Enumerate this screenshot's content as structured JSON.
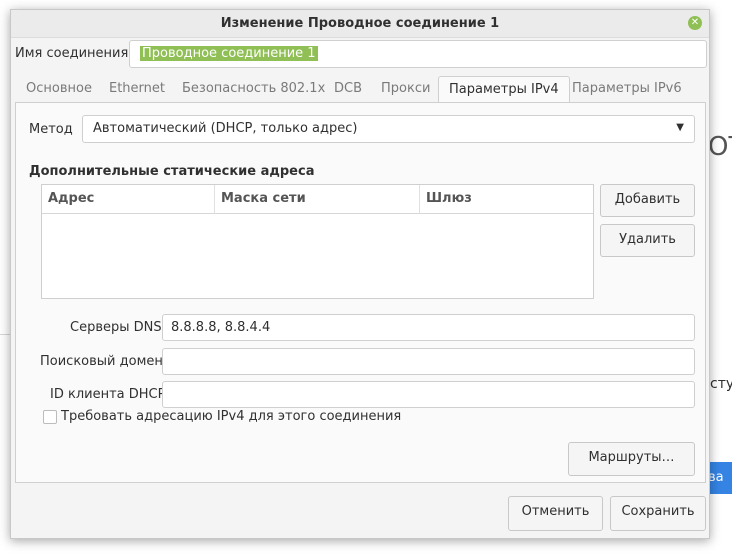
{
  "background": {
    "big_text": "OT",
    "text": "сту",
    "button_label": "ва",
    "accent": "#3584e4"
  },
  "dialog": {
    "title": "Изменение Проводное соединение 1",
    "close_icon": "close-icon"
  },
  "connection_name": {
    "label": "Имя соединения",
    "value": "Проводное соединение 1"
  },
  "tabs": [
    {
      "label": "Основное"
    },
    {
      "label": "Ethernet"
    },
    {
      "label": "Безопасность 802.1x"
    },
    {
      "label": "DCB"
    },
    {
      "label": "Прокси"
    },
    {
      "label": "Параметры IPv4"
    },
    {
      "label": "Параметры IPv6"
    }
  ],
  "active_tab": "Параметры IPv4",
  "ipv4": {
    "method_label": "Метод",
    "method_value": "Автоматический (DHCP, только адрес)",
    "static_title": "Дополнительные статические адреса",
    "columns": [
      "Адрес",
      "Маска сети",
      "Шлюз"
    ],
    "add_button": "Добавить",
    "delete_button": "Удалить",
    "dns_label": "Серверы DNS",
    "dns_value": "8.8.8.8, 8.8.4.4",
    "search_domain_label": "Поисковый домен",
    "search_domain_value": "",
    "dhcp_client_label": "ID клиента DHCP",
    "dhcp_client_value": "",
    "require_ipv4_label": "Требовать адресацию IPv4 для этого соединения",
    "require_ipv4_checked": false,
    "routes_button": "Маршруты…"
  },
  "footer": {
    "cancel": "Отменить",
    "save": "Сохранить"
  },
  "colors": {
    "selection": "#8fbf55",
    "dialog_bg": "#f4f4f4"
  }
}
